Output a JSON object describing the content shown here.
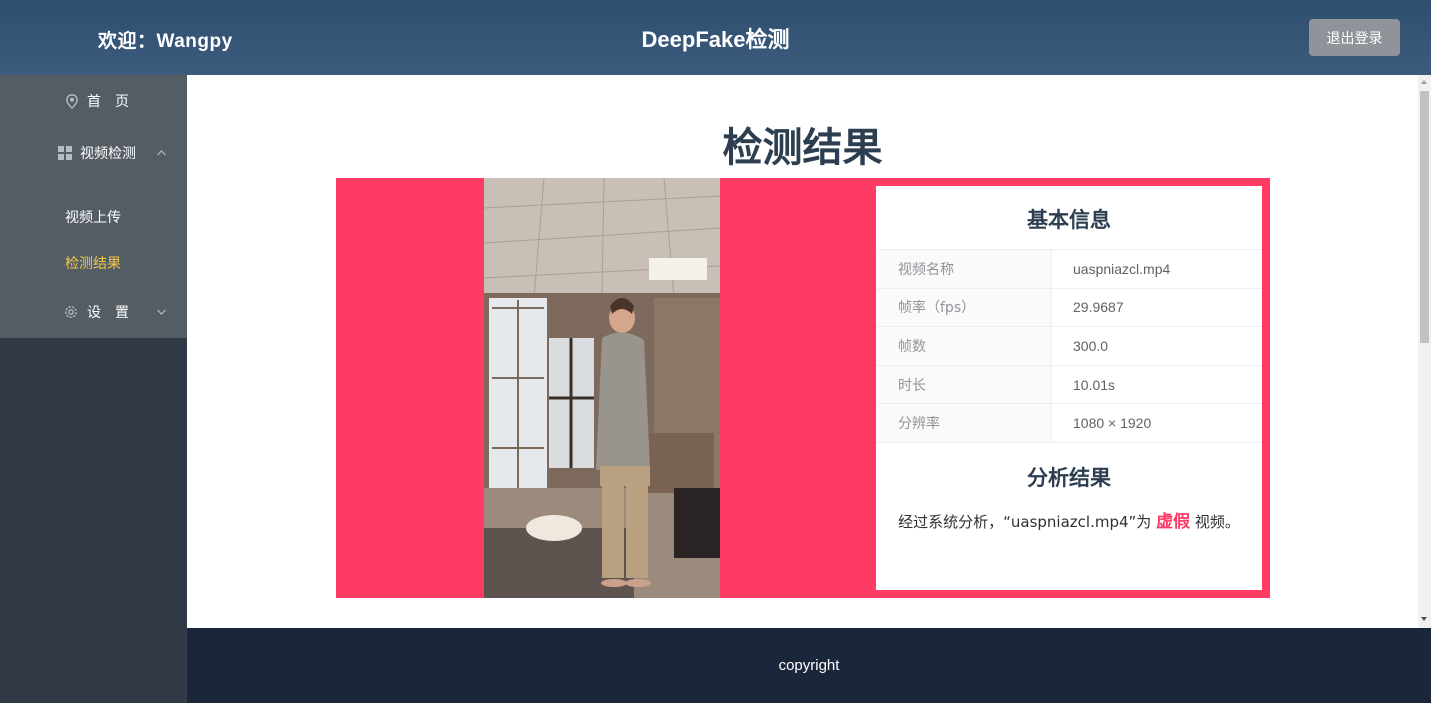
{
  "header": {
    "welcome": "欢迎：Wangpy",
    "title": "DeepFake检测",
    "logout_label": "退出登录"
  },
  "sidebar": {
    "items": [
      {
        "label": "首　页",
        "icon": "location-pin-icon"
      },
      {
        "label": "视频检测",
        "icon": "grid-icon",
        "expanded": true,
        "children": [
          {
            "label": "视频上传",
            "active": false
          },
          {
            "label": "检测结果",
            "active": true
          }
        ]
      },
      {
        "label": "设　置",
        "icon": "gear-icon",
        "expanded": false
      }
    ]
  },
  "main": {
    "title": "检测结果",
    "basic_info_title": "基本信息",
    "info_rows": [
      {
        "key": "视频名称",
        "value": "uaspniazcl.mp4"
      },
      {
        "key": "帧率（fps）",
        "value": "29.9687"
      },
      {
        "key": "帧数",
        "value": "300.0"
      },
      {
        "key": "时长",
        "value": "10.01s"
      },
      {
        "key": "分辨率",
        "value": "1080 × 1920"
      }
    ],
    "analysis_title": "分析结果",
    "analysis_prefix": "经过系统分析，“uaspniazcl.mp4”为",
    "analysis_verdict": "虚假",
    "analysis_suffix": "视频。"
  },
  "footer": {
    "text": "copyright"
  },
  "colors": {
    "header_bg": "#3d5b7d",
    "sidebar_bg": "#323a48",
    "menu_bg": "#545c64",
    "active_text": "#f4c946",
    "panel_accent": "#fd3b65",
    "footer_bg": "#1a2639",
    "logout_bg": "#909399"
  }
}
